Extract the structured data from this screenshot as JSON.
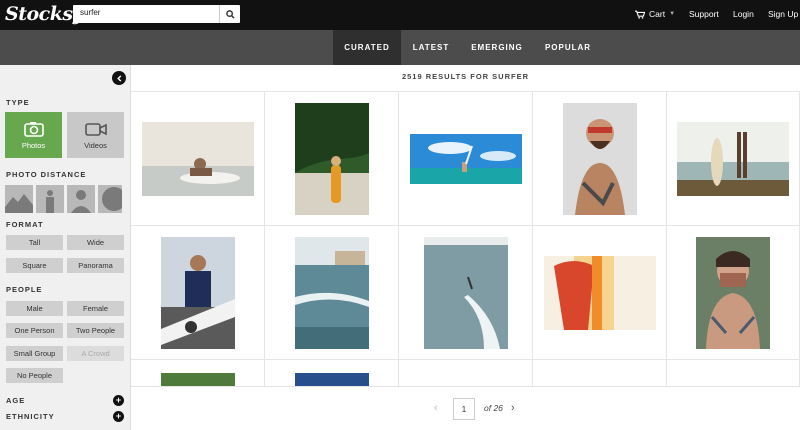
{
  "header": {
    "logo": "Stocksy",
    "search_value": "surfer",
    "cart_label": "Cart",
    "support_label": "Support",
    "login_label": "Login",
    "signup_label": "Sign Up"
  },
  "tabs": [
    {
      "label": "CURATED",
      "active": true
    },
    {
      "label": "LATEST"
    },
    {
      "label": "EMERGING"
    },
    {
      "label": "POPULAR"
    }
  ],
  "sidebar": {
    "type_title": "TYPE",
    "photos_label": "Photos",
    "videos_label": "Videos",
    "distance_title": "PHOTO DISTANCE",
    "format_title": "FORMAT",
    "format": [
      "Tall",
      "Wide",
      "Square",
      "Panorama"
    ],
    "people_title": "PEOPLE",
    "people": [
      "Male",
      "Female",
      "One Person",
      "Two People",
      "Small Group",
      "A Crowd",
      "No People"
    ],
    "age_title": "AGE",
    "ethnicity_title": "ETHNICITY"
  },
  "results_text": "2519 RESULTS FOR SURFER",
  "pagination": {
    "current": "1",
    "of_text": "of 26"
  },
  "colors": {
    "accent_green": "#67a84f",
    "topbar": "#111111",
    "subnav": "#4c4c4c"
  }
}
